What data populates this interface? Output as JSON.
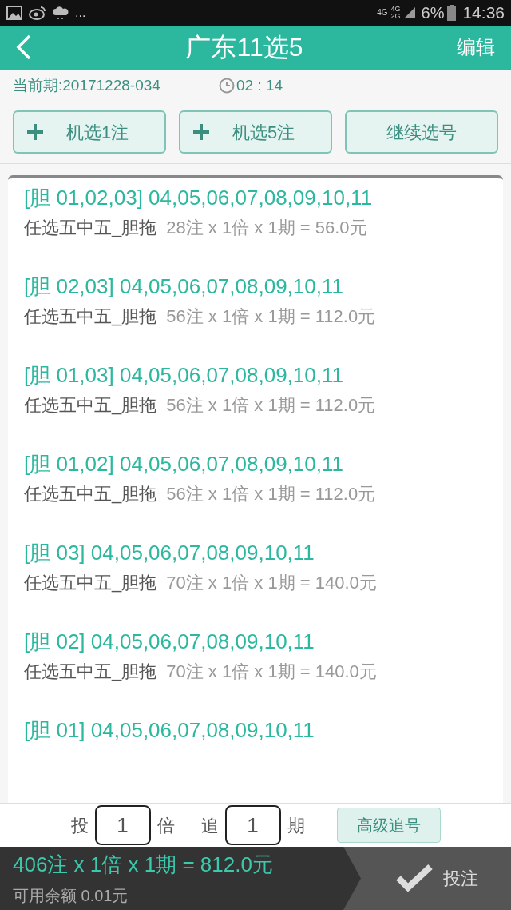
{
  "status_bar": {
    "more": "...",
    "network": [
      "4G",
      "4G",
      "2G"
    ],
    "battery": "6%",
    "time": "14:36"
  },
  "header": {
    "title": "广东11选5",
    "action": "编辑"
  },
  "period": {
    "label": "当前期:20171228-034",
    "countdown": "02 : 14"
  },
  "actions": [
    {
      "label": "机选1注",
      "kind": "add"
    },
    {
      "label": "机选5注",
      "kind": "add"
    },
    {
      "label": "继续选号",
      "kind": "plain"
    }
  ],
  "bets": [
    {
      "title": "[胆 01,02,03] 04,05,06,07,08,09,10,11",
      "play": "任选五中五_胆拖",
      "detail": "28注 x 1倍 x 1期 = 56.0元"
    },
    {
      "title": "[胆 02,03] 04,05,06,07,08,09,10,11",
      "play": "任选五中五_胆拖",
      "detail": "56注 x 1倍 x 1期 = 112.0元"
    },
    {
      "title": "[胆 01,03] 04,05,06,07,08,09,10,11",
      "play": "任选五中五_胆拖",
      "detail": "56注 x 1倍 x 1期 = 112.0元"
    },
    {
      "title": "[胆 01,02] 04,05,06,07,08,09,10,11",
      "play": "任选五中五_胆拖",
      "detail": "56注 x 1倍 x 1期 = 112.0元"
    },
    {
      "title": "[胆 03] 04,05,06,07,08,09,10,11",
      "play": "任选五中五_胆拖",
      "detail": "70注 x 1倍 x 1期 = 140.0元"
    },
    {
      "title": "[胆 02] 04,05,06,07,08,09,10,11",
      "play": "任选五中五_胆拖",
      "detail": "70注 x 1倍 x 1期 = 140.0元"
    },
    {
      "title": "[胆 01] 04,05,06,07,08,09,10,11"
    }
  ],
  "multiple": {
    "prefix": "投",
    "value": "1",
    "suffix": "倍"
  },
  "chase": {
    "prefix": "追",
    "value": "1",
    "suffix": "期"
  },
  "advanced_button": "高级追号",
  "summary": {
    "total": "406注 x 1倍 x 1期 = 812.0元",
    "balance": "可用余额 0.01元"
  },
  "submit": "投注"
}
